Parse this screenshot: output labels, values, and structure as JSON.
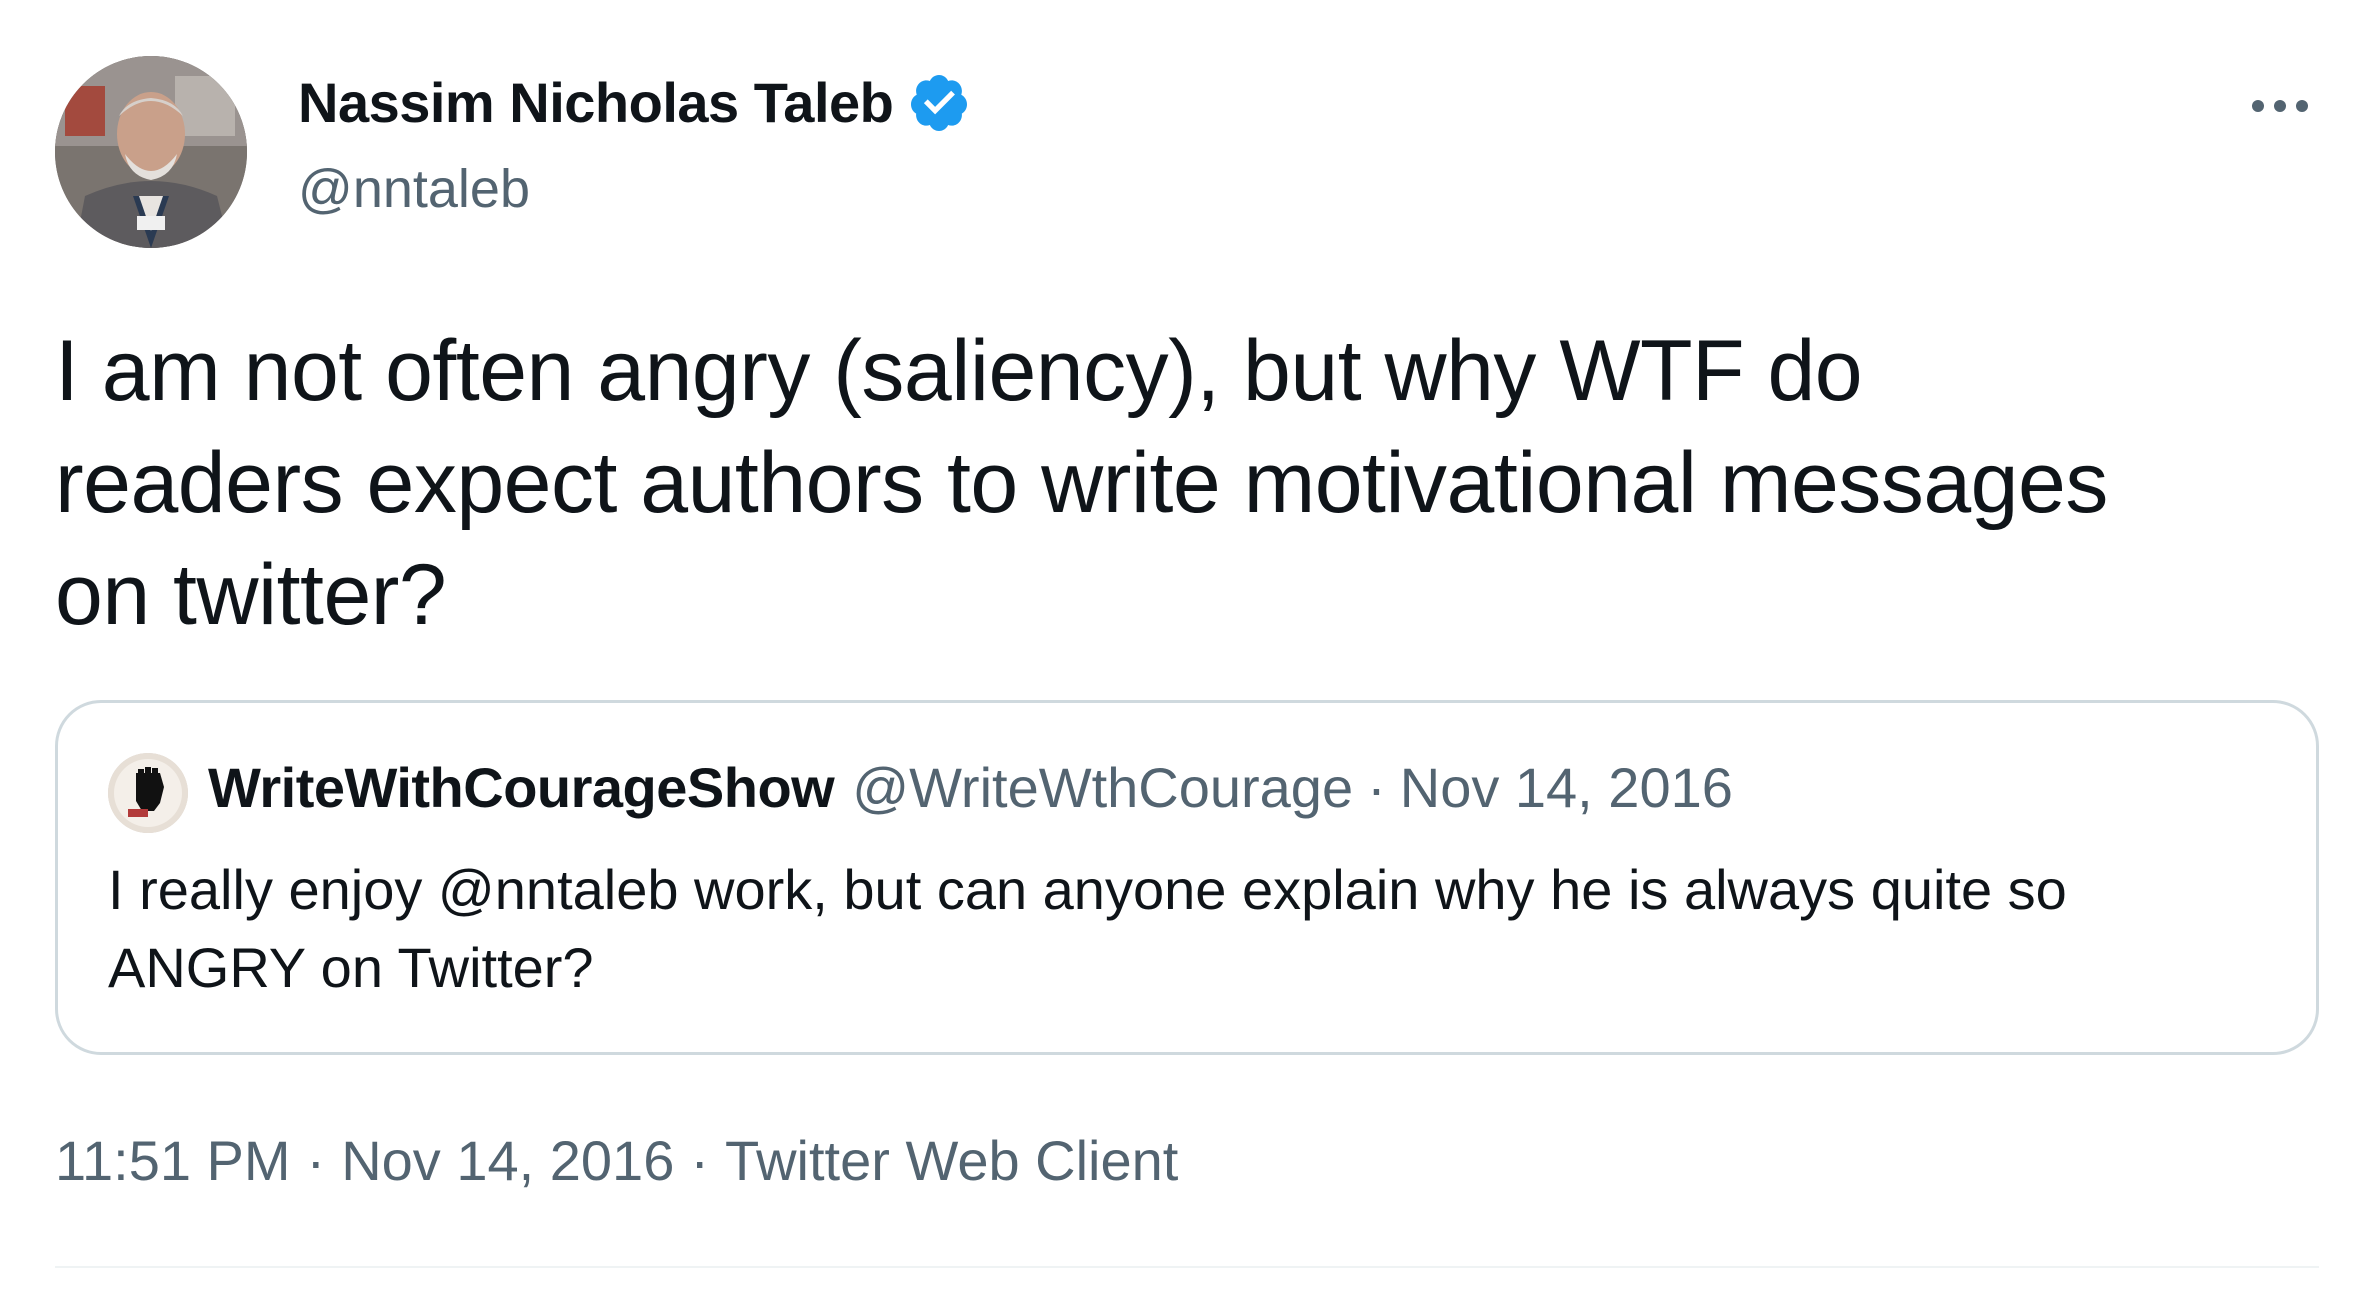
{
  "colors": {
    "text": "#0f1419",
    "secondary": "#536471",
    "verified": "#1d9bf0",
    "border": "#cfd9de"
  },
  "author": {
    "name": "Nassim Nicholas Taleb",
    "handle": "@nntaleb",
    "verified": true,
    "avatar_icon": "profile-photo"
  },
  "more_icon": "more-horizontal-icon",
  "tweet": {
    "text": "I am not often angry (saliency), but why WTF do\nreaders expect authors to write motivational messages\non twitter?"
  },
  "quote": {
    "name": "WriteWithCourageShow",
    "handle": "@WriteWthCourage",
    "separator": "·",
    "date": "Nov 14, 2016",
    "text": "I really enjoy @nntaleb work, but can anyone explain why he is always quite so\nANGRY on Twitter?"
  },
  "meta": {
    "time": "11:51 PM",
    "date": "Nov 14, 2016",
    "source": "Twitter Web Client",
    "separator": "·"
  }
}
